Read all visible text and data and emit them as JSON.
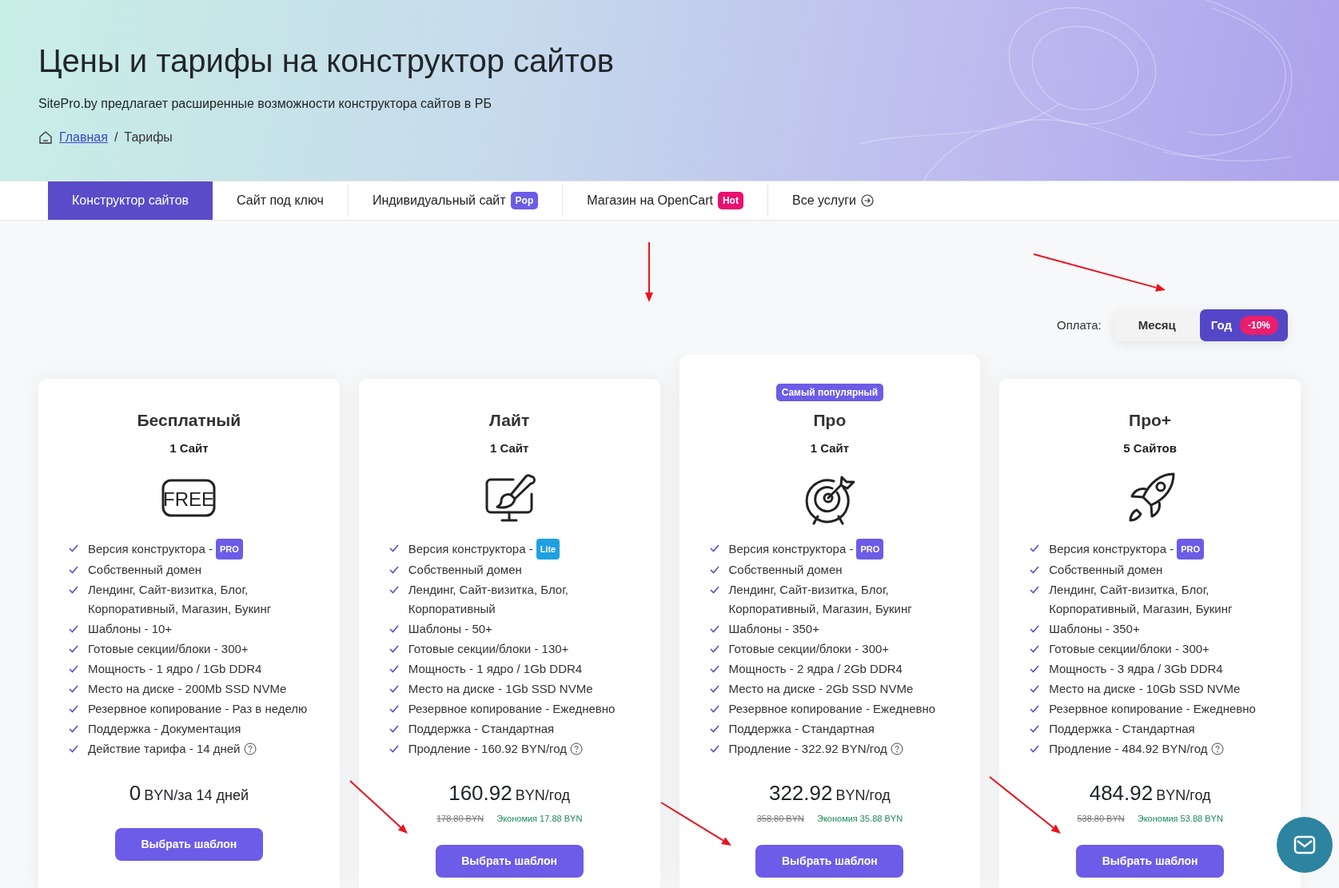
{
  "header": {
    "title": "Цены и тарифы на конструктор сайтов",
    "subtitle": "SitePro.by предлагает расширенные возможности конструктора сайтов в РБ",
    "breadcrumbs": [
      {
        "label": "Главная",
        "kind": "link"
      },
      {
        "label": "Тарифы",
        "kind": "current"
      }
    ],
    "separator": "/"
  },
  "tabs": [
    {
      "label": "Конструктор сайтов",
      "selected": true
    },
    {
      "label": "Сайт под ключ",
      "selected": false
    },
    {
      "label": "Индивидуальный сайт",
      "selected": false,
      "badge": "Pop",
      "color": "#6c5ce7"
    },
    {
      "label": "Магазин на OpenCart",
      "selected": false,
      "badge": "Hot",
      "color": "#e8106e"
    },
    {
      "label": "Все услуги",
      "selected": false,
      "arrow": true
    }
  ],
  "billing": {
    "label": "Оплата:",
    "options": [
      {
        "label": "Месяц",
        "selected": false
      },
      {
        "label": "Год",
        "selected": true,
        "badge": "-10%"
      }
    ]
  },
  "plans": [
    {
      "name": "Бесплатный",
      "sites": "1 Сайт",
      "icon_label": "FREE",
      "featured": false,
      "features": [
        {
          "text": "Версия конструктора -",
          "badge": "PRO",
          "color": "#6c5ce7"
        },
        {
          "text": "Собственный домен"
        },
        {
          "text": "Лендинг, Сайт-визитка, Блог, Корпоративный, Магазин, Букинг"
        },
        {
          "text": "Шаблоны - 10+"
        },
        {
          "text": "Готовые секции/блоки - 300+"
        },
        {
          "text": "Мощность - 1 ядро / 1Gb DDR4"
        },
        {
          "text": "Место на диске - 200Mb SSD NVMe"
        },
        {
          "text": "Резервное копирование - Раз в неделю"
        },
        {
          "text": "Поддержка - Документация"
        },
        {
          "text": "Действие тарифа - 14 дней",
          "help": true
        }
      ],
      "price": "0",
      "unit": "BYN/за 14 дней",
      "button": "Выбрать шаблон"
    },
    {
      "name": "Лайт",
      "sites": "1 Сайт",
      "featured": false,
      "features": [
        {
          "text": "Версия конструктора -",
          "badge": "Lite",
          "color": "#1fa0e0"
        },
        {
          "text": "Собственный домен"
        },
        {
          "text": "Лендинг, Сайт-визитка, Блог, Корпоративный"
        },
        {
          "text": "Шаблоны - 50+"
        },
        {
          "text": "Готовые секции/блоки - 130+"
        },
        {
          "text": "Мощность - 1 ядро / 1Gb DDR4"
        },
        {
          "text": "Место на диске - 1Gb SSD NVMe"
        },
        {
          "text": "Резервное копирование - Ежедневно"
        },
        {
          "text": "Поддержка - Стандартная"
        },
        {
          "text": "Продление - 160.92 BYN/год",
          "help": true
        }
      ],
      "price": "160.92",
      "unit": "BYN/год",
      "old_price": "178.80 BYN",
      "saving": "Экономия 17.88 BYN",
      "button": "Выбрать шаблон"
    },
    {
      "name": "Про",
      "sites": "1 Сайт",
      "featured": true,
      "ribbon": "Самый популярный",
      "features": [
        {
          "text": "Версия конструктора -",
          "badge": "PRO",
          "color": "#6c5ce7"
        },
        {
          "text": "Собственный домен"
        },
        {
          "text": "Лендинг, Сайт-визитка, Блог, Корпоративный, Магазин, Букинг"
        },
        {
          "text": "Шаблоны - 350+"
        },
        {
          "text": "Готовые секции/блоки - 300+"
        },
        {
          "text": "Мощность - 2 ядра / 2Gb DDR4"
        },
        {
          "text": "Место на диске - 2Gb SSD NVMe"
        },
        {
          "text": "Резервное копирование - Ежедневно"
        },
        {
          "text": "Поддержка - Стандартная"
        },
        {
          "text": "Продление - 322.92 BYN/год",
          "help": true
        }
      ],
      "price": "322.92",
      "unit": "BYN/год",
      "old_price": "358.80 BYN",
      "saving": "Экономия 35.88 BYN",
      "button": "Выбрать шаблон"
    },
    {
      "name": "Про+",
      "sites": "5 Сайтов",
      "featured": false,
      "features": [
        {
          "text": "Версия конструктора -",
          "badge": "PRO",
          "color": "#6c5ce7"
        },
        {
          "text": "Собственный домен"
        },
        {
          "text": "Лендинг, Сайт-визитка, Блог, Корпоративный, Магазин, Букинг"
        },
        {
          "text": "Шаблоны - 350+"
        },
        {
          "text": "Готовые секции/блоки - 300+"
        },
        {
          "text": "Мощность - 3 ядра / 3Gb DDR4"
        },
        {
          "text": "Место на диске - 10Gb SSD NVMe"
        },
        {
          "text": "Резервное копирование - Ежедневно"
        },
        {
          "text": "Поддержка - Стандартная"
        },
        {
          "text": "Продление - 484.92 BYN/год",
          "help": true
        }
      ],
      "price": "484.92",
      "unit": "BYN/год",
      "old_price": "538.80 BYN",
      "saving": "Экономия 53.88 BYN",
      "button": "Выбрать шаблон"
    }
  ]
}
